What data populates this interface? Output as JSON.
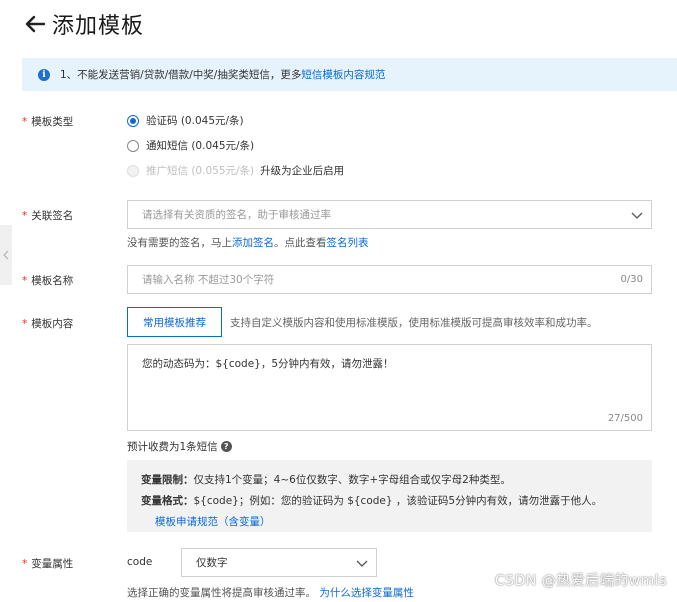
{
  "header": {
    "title": "添加模板"
  },
  "notice": {
    "text": "1、不能发送营销/贷款/借款/中奖/抽奖类短信，更多",
    "link": "短信模板内容规范"
  },
  "form": {
    "type": {
      "label": "模板类型",
      "options": [
        {
          "label": "验证码 (0.045元/条)",
          "checked": true
        },
        {
          "label": "通知短信 (0.045元/条)",
          "checked": false
        },
        {
          "label": "推广短信 (0.055元/条)",
          "disabled": true,
          "note": "升级为企业后启用"
        }
      ]
    },
    "sign": {
      "label": "关联签名",
      "placeholder": "请选择有关资质的签名，助于审核通过率",
      "hint_prefix": "没有需要的签名，马上",
      "hint_link1": "添加签名",
      "hint_mid": "。点此查看",
      "hint_link2": "签名列表"
    },
    "name": {
      "label": "模板名称",
      "placeholder": "请输入名称 不超过30个字符",
      "counter": "0/30"
    },
    "content": {
      "label": "模板内容",
      "button": "常用模板推荐",
      "desc": "支持自定义模版内容和使用标准模版，使用标准模版可提高审核效率和成功率。",
      "value": "您的动态码为：${code}，5分钟内有效，请勿泄露！",
      "counter": "27/500",
      "fee": "预计收费为1条短信"
    },
    "var_panel": {
      "limit_label": "变量限制：",
      "limit_text": "仅支持1个变量；4~6位仅数字、数字+字母组合或仅字母2种类型。",
      "format_label": "变量格式：",
      "format_text": "${code}；例如：您的验证码为 ${code} ，该验证码5分钟内有效，请勿泄露于他人。",
      "link": "模板申请规范（含变量）"
    },
    "var_attr": {
      "label": "变量属性",
      "var_name": "code",
      "selected": "仅数字",
      "hint": "选择正确的变量属性将提高审核通过率。",
      "hint_link": "为什么选择变量属性"
    }
  },
  "watermark": "CSDN @热爱后端的wmls",
  "colors": {
    "accent": "#0b6ad8",
    "required": "#e0321e",
    "notice_bg": "#e6f3fd"
  }
}
